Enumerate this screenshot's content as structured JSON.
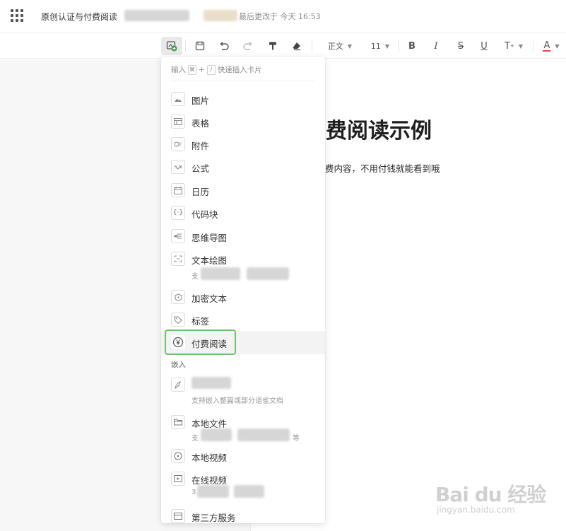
{
  "header": {
    "title": "原创认证与付费阅读",
    "save_status": "最后更改于 今天 16:53"
  },
  "toolbar": {
    "insert_icon": "insert-card-icon",
    "save_icon": "save-icon",
    "undo_icon": "undo-icon",
    "redo_icon": "redo-icon",
    "format_painter_icon": "format-painter-icon",
    "clear_format_icon": "clear-format-icon",
    "paragraph_style": "正文",
    "font_size": "11",
    "bold": "B",
    "italic": "I",
    "strikethrough": "S",
    "underline": "U",
    "superscript": "T",
    "font_color": "A",
    "font_color_value": "#e2453b"
  },
  "insert_panel": {
    "hint_prefix": "输入",
    "hint_key1": "⌘",
    "hint_plus": "+",
    "hint_key2": "/",
    "hint_suffix": "快速插入卡片",
    "items": [
      {
        "label": "图片",
        "icon": "image-icon"
      },
      {
        "label": "表格",
        "icon": "table-icon"
      },
      {
        "label": "附件",
        "icon": "attachment-icon"
      },
      {
        "label": "公式",
        "icon": "formula-icon"
      },
      {
        "label": "日历",
        "icon": "calendar-icon"
      },
      {
        "label": "代码块",
        "icon": "code-block-icon"
      },
      {
        "label": "思维导图",
        "icon": "mindmap-icon"
      },
      {
        "label": "文本绘图",
        "icon": "text-drawing-icon",
        "sub": "支"
      },
      {
        "label": "加密文本",
        "icon": "encrypted-text-icon"
      },
      {
        "label": "标签",
        "icon": "tag-icon"
      },
      {
        "label": "付费阅读",
        "icon": "paid-reading-icon"
      }
    ],
    "embed_section_label": "嵌入",
    "embed_items": [
      {
        "label": "",
        "icon": "yuque-doc-icon",
        "sub": "支持嵌入整篇或部分语雀文档"
      },
      {
        "label": "本地文件",
        "icon": "local-file-icon",
        "sub": "支",
        "sub_tail": "等"
      },
      {
        "label": "本地视频",
        "icon": "local-video-icon"
      },
      {
        "label": "在线视频",
        "icon": "online-video-icon",
        "sub": "3"
      },
      {
        "label": "第三方服务",
        "icon": "third-party-service-icon"
      }
    ]
  },
  "document": {
    "heading": "费阅读示例",
    "body": "费内容，不用付钱就能看到哦"
  },
  "watermark": {
    "brand": "Bai du 经验",
    "url": "jingyan.baidu.com"
  },
  "colors": {
    "focus_ring": "#6bc36b",
    "insert_icon_green": "#35a34a"
  }
}
